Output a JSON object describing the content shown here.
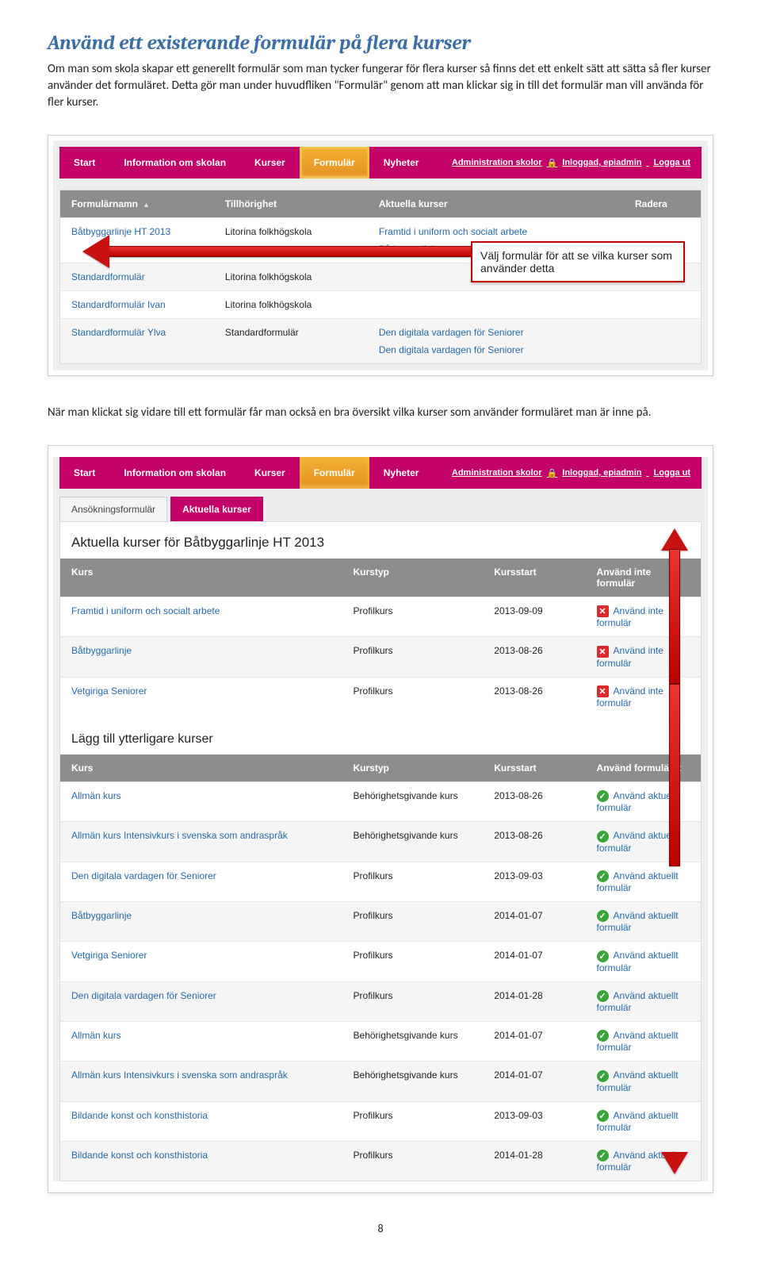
{
  "heading": "Använd ett existerande formulär på flera kurser",
  "para1": "Om man som skola skapar ett generellt formulär som man tycker fungerar för flera kurser så finns det ett enkelt sätt att sätta så fler kurser använder det formuläret. Detta gör man under huvudfliken \"Formulär\" genom att man klickar sig in till det formulär man vill använda för fler kurser.",
  "para2": "När man klickat sig vidare till ett formulär får man också en bra översikt vilka kurser som använder formuläret man är inne på.",
  "menu": {
    "start": "Start",
    "info": "Information om skolan",
    "kurser": "Kurser",
    "formular": "Formulär",
    "nyheter": "Nyheter",
    "admin": "Administration skolor",
    "logged": "Inloggad, epiadmin",
    "logout": "Logga ut"
  },
  "sc1": {
    "headers": {
      "name": "Formulärnamn",
      "till": "Tillhörighet",
      "ak": "Aktuella kurser",
      "rad": "Radera"
    },
    "rows": [
      {
        "name": "Båtbyggarlinje HT 2013",
        "till": "Litorina folkhögskola",
        "ak": [
          "Framtid i uniform och socialt arbete",
          "Båtbyggarlinje"
        ]
      },
      {
        "name": "Standardformulär",
        "till": "Litorina folkhögskola",
        "ak": []
      },
      {
        "name": "Standardformulär Ivan",
        "till": "Litorina folkhögskola",
        "ak": []
      },
      {
        "name": "Standardformulär Ylva",
        "till": "Standardformulär",
        "ak": [
          "Den digitala vardagen för Seniorer",
          "Den digitala vardagen för Seniorer"
        ]
      }
    ],
    "callout": "Välj formulär för att se vilka kurser som använder detta"
  },
  "sc2": {
    "tabs": {
      "t1": "Ansökningsformulär",
      "t2": "Aktuella kurser"
    },
    "title": "Aktuella kurser för Båtbyggarlinje HT 2013",
    "headers": {
      "kurs": "Kurs",
      "typ": "Kurstyp",
      "start": "Kursstart",
      "use1": "Använd inte formulär",
      "use2": "Använd formuläret"
    },
    "top_rows": [
      {
        "kurs": "Framtid i uniform och socialt arbete",
        "typ": "Profilkurs",
        "start": "2013-09-09",
        "label": "Använd inte formulär"
      },
      {
        "kurs": "Båtbyggarlinje",
        "typ": "Profilkurs",
        "start": "2013-08-26",
        "label": "Använd inte formulär"
      },
      {
        "kurs": "Vetgiriga Seniorer",
        "typ": "Profilkurs",
        "start": "2013-08-26",
        "label": "Använd inte formulär"
      }
    ],
    "subhead": "Lägg till ytterligare kurser",
    "bottom_rows": [
      {
        "kurs": "Allmän kurs",
        "typ": "Behörighetsgivande kurs",
        "start": "2013-08-26",
        "label": "Använd aktuellt formulär"
      },
      {
        "kurs": "Allmän kurs Intensivkurs i svenska som andraspråk",
        "typ": "Behörighetsgivande kurs",
        "start": "2013-08-26",
        "label": "Använd aktuellt formulär"
      },
      {
        "kurs": "Den digitala vardagen för Seniorer",
        "typ": "Profilkurs",
        "start": "2013-09-03",
        "label": "Använd aktuellt formulär"
      },
      {
        "kurs": "Båtbyggarlinje",
        "typ": "Profilkurs",
        "start": "2014-01-07",
        "label": "Använd aktuellt formulär"
      },
      {
        "kurs": "Vetgiriga Seniorer",
        "typ": "Profilkurs",
        "start": "2014-01-07",
        "label": "Använd aktuellt formulär"
      },
      {
        "kurs": "Den digitala vardagen för Seniorer",
        "typ": "Profilkurs",
        "start": "2014-01-28",
        "label": "Använd aktuellt formulär"
      },
      {
        "kurs": "Allmän kurs",
        "typ": "Behörighetsgivande kurs",
        "start": "2014-01-07",
        "label": "Använd aktuellt formulär"
      },
      {
        "kurs": "Allmän kurs Intensivkurs i svenska som andraspråk",
        "typ": "Behörighetsgivande kurs",
        "start": "2014-01-07",
        "label": "Använd aktuellt formulär"
      },
      {
        "kurs": "Bildande konst och konsthistoria",
        "typ": "Profilkurs",
        "start": "2013-09-03",
        "label": "Använd aktuellt formulär"
      },
      {
        "kurs": "Bildande konst och konsthistoria",
        "typ": "Profilkurs",
        "start": "2014-01-28",
        "label": "Använd aktuellt formulär"
      }
    ]
  },
  "pagenum": "8"
}
